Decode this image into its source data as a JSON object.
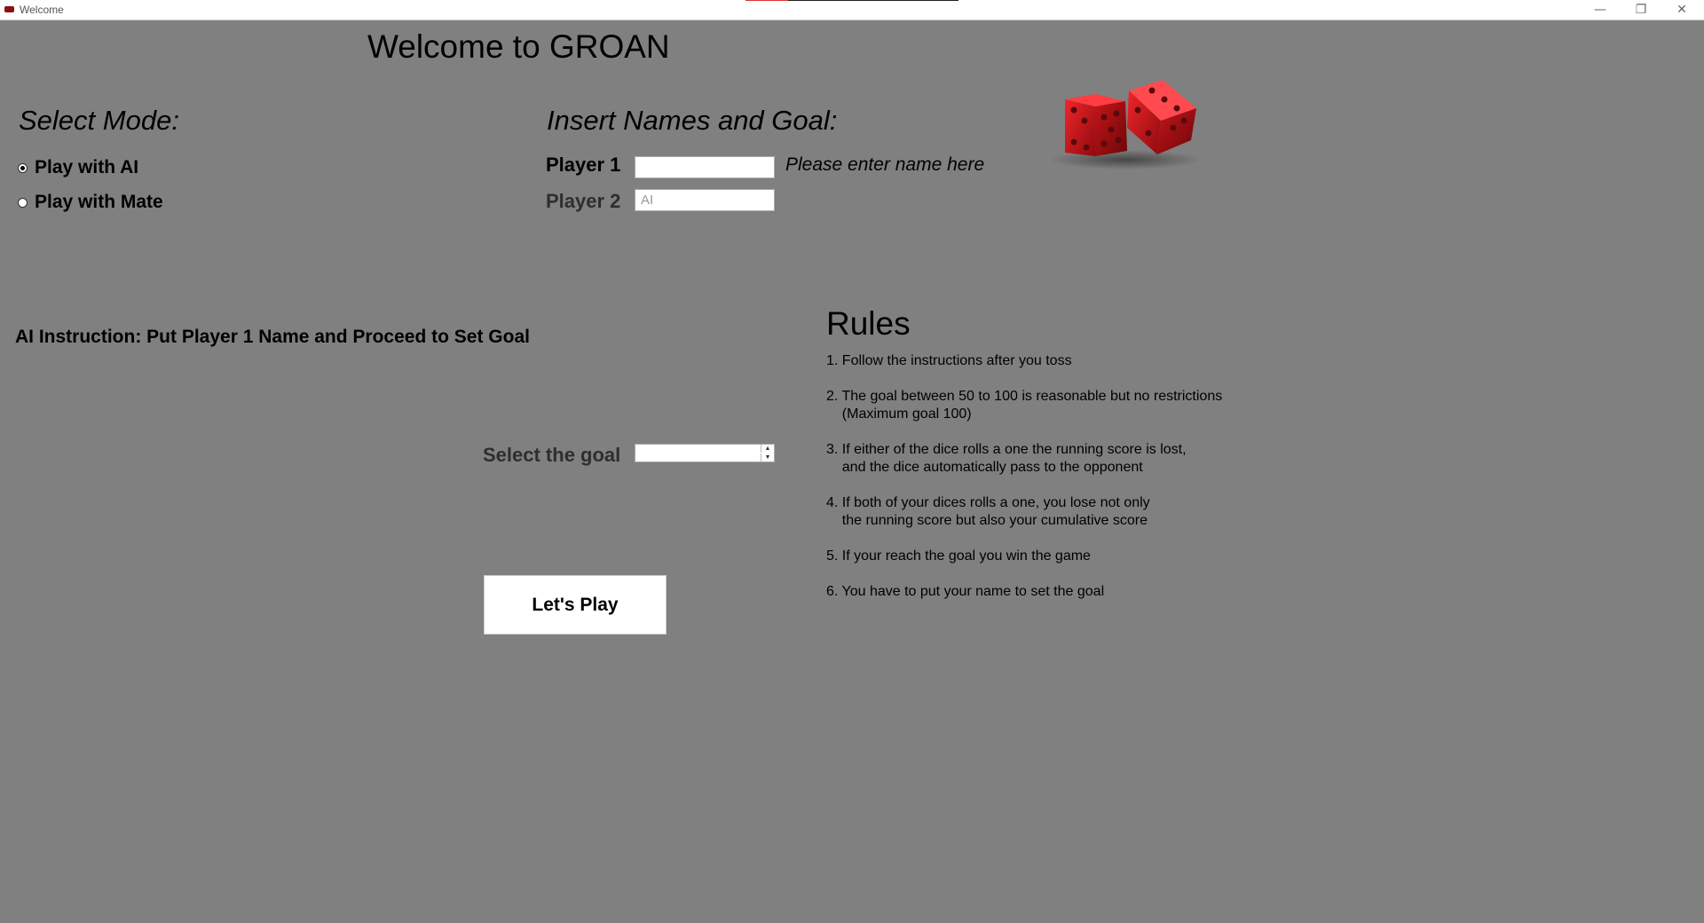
{
  "window": {
    "title": "Welcome",
    "minimize_icon": "minimize-icon",
    "maximize_icon": "restore-icon",
    "close_icon": "close-icon"
  },
  "page_title": "Welcome to GROAN",
  "mode": {
    "heading": "Select Mode:",
    "options": [
      {
        "label": "Play with AI",
        "checked": true
      },
      {
        "label": "Play with Mate",
        "checked": false
      }
    ]
  },
  "names": {
    "heading": "Insert Names and Goal:",
    "player1_label": "Player 1",
    "player1_value": "",
    "player1_hint": "Please enter name here",
    "player2_label": "Player 2",
    "player2_value": "AI"
  },
  "instruction": "AI Instruction: Put Player 1 Name and Proceed to Set Goal",
  "goal": {
    "label": "Select the goal",
    "value": ""
  },
  "play_button": "Let's Play",
  "rules": {
    "title": "Rules",
    "items": [
      "1. Follow the instructions after you toss",
      "2. The goal between 50 to 100 is reasonable but no restrictions\n    (Maximum goal 100)",
      "3. If either of the dice rolls a one the running score is lost,\n    and the dice automatically pass to the opponent",
      "4. If both of your dices rolls a one, you lose not only\n    the running score but also your cumulative score",
      "5. If your reach the goal you win the game",
      "6. You have to put your name to set the goal"
    ]
  },
  "colors": {
    "background": "#808080",
    "dice": "#d4171a",
    "disabled_text": "#2e2e2e"
  }
}
